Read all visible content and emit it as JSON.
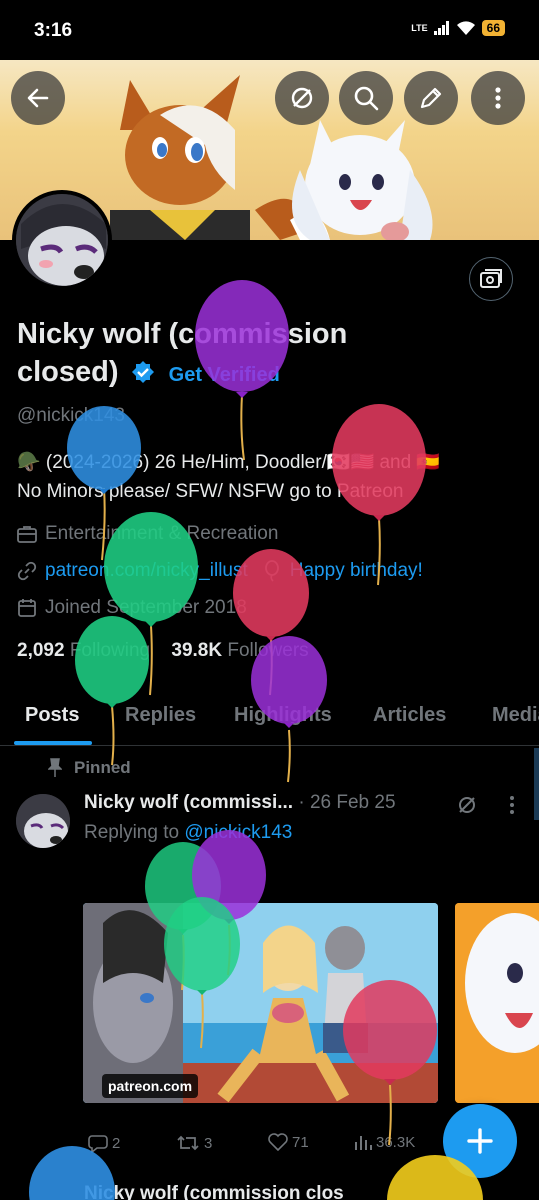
{
  "status_bar": {
    "time": "3:16",
    "network": "LTE",
    "battery": "66"
  },
  "profile": {
    "name": "Nicky wolf (commission closed)",
    "get_verified": "Get Verified",
    "handle": "@nickick143",
    "bio_line1": "🪖 (2024-2026) 26 He/Him, Doodler/🇰🇷🇺🇸 and 🇪🇸",
    "bio_line2": "No Minors please/ SFW/ NSFW go to Patreon",
    "category": "Entertainment & Recreation",
    "website": "patreon.com/nicky_illust",
    "birthday": "Happy birthday!",
    "joined": "Joined September 2018",
    "following_count": "2,092",
    "following_label": "Following",
    "followers_count": "39.8K",
    "followers_label": "Followers"
  },
  "tabs": [
    "Posts",
    "Replies",
    "Highlights",
    "Articles",
    "Media"
  ],
  "post": {
    "pinned_label": "Pinned",
    "author": "Nicky wolf (commissi...",
    "date": "· 26 Feb 25",
    "reply_prefix": "Replying to",
    "reply_handle": "@nickick143",
    "media_source": "patreon.com",
    "replies": "2",
    "reposts": "3",
    "likes": "71",
    "views": "36.3K"
  },
  "next_post_author": "Nicky wolf (commission clos",
  "icons": {
    "back": "back-arrow-icon",
    "mute": "muted-icon",
    "search": "search-icon",
    "edit": "pencil-icon",
    "more": "more-vertical-icon",
    "banner_edit": "image-edit-icon",
    "compose": "plus-icon"
  },
  "colors": {
    "accent": "#1d9bf0",
    "background": "#000000",
    "muted_text": "#71767b"
  }
}
